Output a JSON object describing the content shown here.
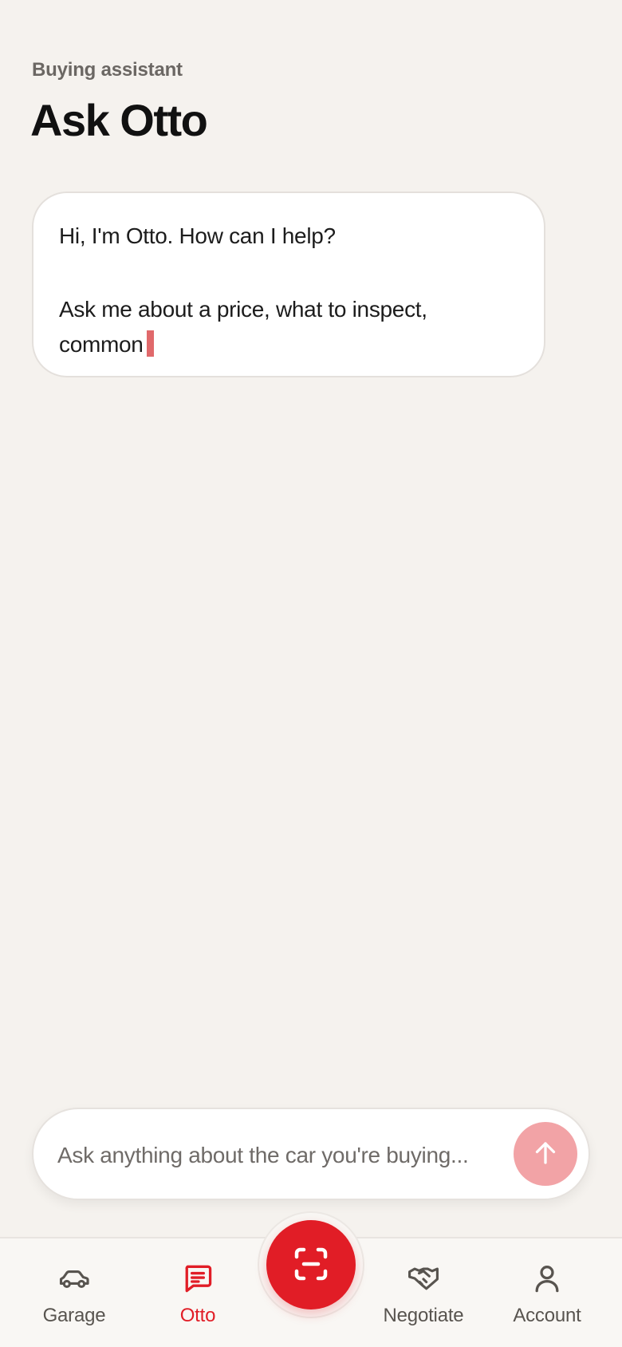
{
  "header": {
    "eyebrow": "Buying assistant",
    "title": "Ask Otto"
  },
  "chat": {
    "messages": [
      {
        "from": "assistant",
        "greeting": "Hi, I'm Otto. How can I help?",
        "body": "Ask me about a price, what to inspect,",
        "body_cont": "common",
        "streaming": true
      }
    ]
  },
  "composer": {
    "placeholder": "Ask anything about the car you're buying...",
    "value": "",
    "send_icon": "arrow-up-icon"
  },
  "nav": {
    "items": [
      {
        "label": "Garage",
        "icon": "car-icon",
        "active": false
      },
      {
        "label": "Otto",
        "icon": "chat-icon",
        "active": true
      },
      {
        "label": "Negotiate",
        "icon": "handshake-icon",
        "active": false
      },
      {
        "label": "Account",
        "icon": "person-icon",
        "active": false
      }
    ],
    "center_action_icon": "scan-icon"
  },
  "colors": {
    "background": "#f5f2ee",
    "accent": "#e11d26",
    "send_disabled": "#f2a3a6",
    "cursor": "#e0696b"
  }
}
